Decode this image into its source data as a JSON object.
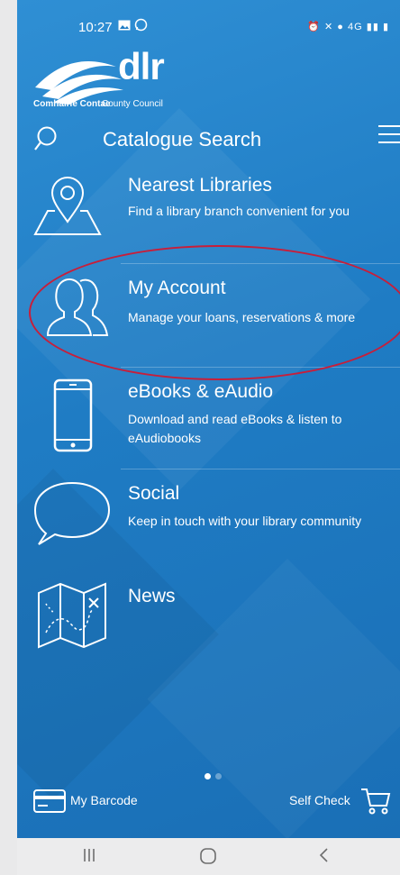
{
  "status_bar": {
    "time": "10:27",
    "left_icons": [
      "image-icon",
      "whatsapp-icon"
    ],
    "right_icons": [
      "alarm-icon",
      "mute-icon",
      "location-icon",
      "4g-icon",
      "signal-icon",
      "battery-icon"
    ],
    "network_label": "4G"
  },
  "brand": {
    "logo_text": "dlr",
    "council_bold": "Comhairle Contae",
    "council_regular": "County Council"
  },
  "search": {
    "label": "Catalogue Search"
  },
  "menu": {
    "items": [
      {
        "title": "Nearest Libraries",
        "description": "Find a library branch convenient for you",
        "icon": "map-pin-icon"
      },
      {
        "title": "My Account",
        "description": "Manage your loans, reservations & more",
        "icon": "users-icon"
      },
      {
        "title": "eBooks & eAudio",
        "description": "Download and read eBooks & listen to eAudiobooks",
        "icon": "phone-icon"
      },
      {
        "title": "Social",
        "description": "Keep in touch with your library community",
        "icon": "speech-bubble-icon"
      },
      {
        "title": "News",
        "description": "",
        "icon": "treasure-map-icon"
      }
    ]
  },
  "pager": {
    "pages": 2,
    "current": 1
  },
  "bottom_bar": {
    "barcode_label": "My Barcode",
    "self_check_label": "Self Check"
  },
  "colors": {
    "background": "#1f7cc4",
    "highlight_ring": "#c81e3a",
    "text": "#ffffff"
  }
}
